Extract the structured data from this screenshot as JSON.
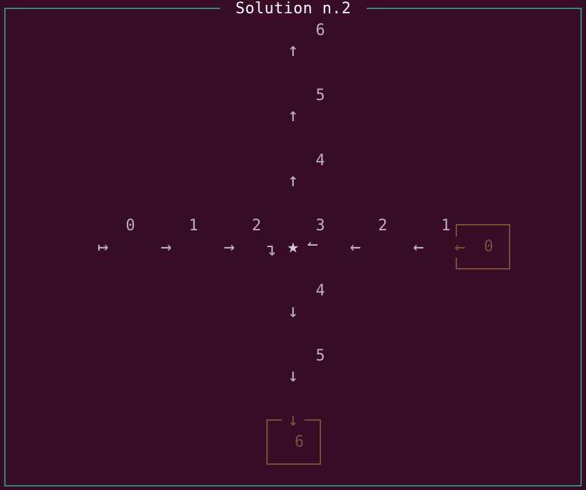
{
  "window": {
    "title": "Solution n.2"
  },
  "grid": {
    "row_labels_horizontal": [
      "0",
      "1",
      "2",
      "3",
      "2",
      "1",
      "0"
    ],
    "column_labels_vertical_top": [
      "6",
      "5",
      "4"
    ],
    "column_labels_vertical_bottom": [
      "4",
      "5",
      "6"
    ],
    "horizontal_arrows": [
      "↦",
      "→",
      "→",
      "↴",
      "★",
      "↼",
      "←",
      "←",
      "←"
    ],
    "vertical_up_arrows": [
      "↑",
      "↑",
      "↑"
    ],
    "vertical_down_arrows": [
      "↓",
      "↓",
      "↓"
    ]
  },
  "start_box": {
    "label": "0",
    "arrow": "←"
  },
  "goal_box": {
    "label": "6",
    "arrow": "↓"
  },
  "colors": {
    "background": "#380c27",
    "frame": "#2e8f6e",
    "text": "#bcb2b9",
    "highlight": "#7b4e38",
    "title": "#ffffff"
  },
  "icons": {
    "center": "star-icon",
    "start": "maps-to-arrow-icon",
    "right": "right-arrow-icon",
    "left": "left-arrow-icon",
    "up": "up-arrow-icon",
    "down": "down-arrow-icon"
  }
}
